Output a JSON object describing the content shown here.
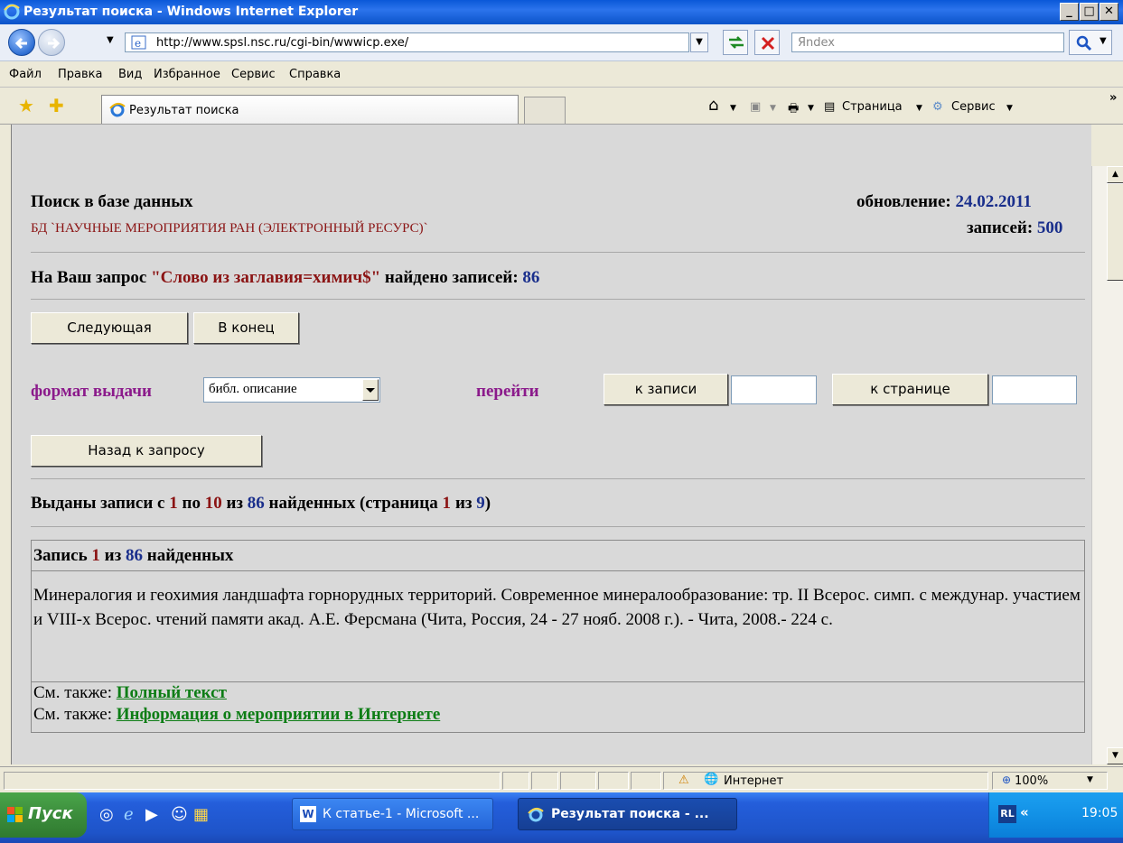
{
  "window": {
    "title": "Результат поиска - Windows Internet Explorer"
  },
  "address_bar": {
    "url": "http://www.spsl.nsc.ru/cgi-bin/wwwicp.exe/",
    "search_placeholder": "Яndex"
  },
  "menu": [
    "Файл",
    "Правка",
    "Вид",
    "Избранное",
    "Сервис",
    "Справка"
  ],
  "tabs": {
    "active_tab": "Результат поиска"
  },
  "command_bar": {
    "page_label": "Страница",
    "tools_label": "Сервис"
  },
  "page": {
    "search_title": "Поиск в базе данных",
    "db_name": "БД `НАУЧНЫЕ МЕРОПРИЯТИЯ РАН (ЭЛЕКТРОННЫЙ РЕСУРС)`",
    "update_label": "обновление:",
    "update_date": "24.02.2011",
    "records_label": "записей:",
    "records_count": "500",
    "query_prefix": "На Ваш запрос",
    "query_text": "\"Слово из заглавия=химич$\"",
    "query_found_label": "найдено записей:",
    "query_found_count": "86",
    "next_button": "Следующая",
    "end_button": "В конец",
    "format_label": "формат выдачи",
    "format_value": "библ. описание",
    "goto_label": "перейти",
    "to_record_button": "к записи",
    "to_page_button": "к странице",
    "back_button": "Назад к запросу",
    "results_summary": {
      "prefix": "Выданы записи с",
      "from": "1",
      "by": "по",
      "to": "10",
      "of": "из",
      "total": "86",
      "found": "найденных (страница",
      "page": "1",
      "of2": "из",
      "pages": "9",
      "close": ")"
    },
    "record": {
      "head_prefix": "Запись",
      "num": "1",
      "of": "из",
      "total": "86",
      "suffix": "найденных",
      "text": "Минералогия и геохимия ландшафта горнорудных территорий. Современное минералообразование: тр. II Всерос. симп. с междунар. участием и VIII-х Всерос. чтений памяти акад. А.Е. Ферсмана (Чита, Россия, 24 - 27 нояб. 2008 г.). - Чита, 2008.- 224 с.",
      "see_also_label": "См. также:",
      "link1": "Полный текст",
      "link2": "Информация о мероприятии в Интернете"
    }
  },
  "status_bar": {
    "zone": "Интернет",
    "zoom": "100%"
  },
  "taskbar": {
    "start": "Пуск",
    "items": [
      "К статье-1 - Microsoft ...",
      "Результат поиска - ..."
    ],
    "lang": "RL",
    "time": "19:05"
  }
}
